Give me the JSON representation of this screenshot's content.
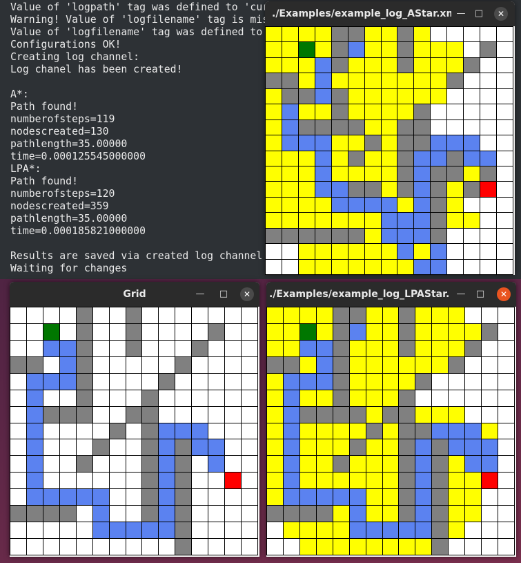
{
  "terminal": {
    "lines": [
      "Value of 'logpath' tag was defined to 'current directory'",
      "Warning! Value of 'logfilename' tag is missing!",
      "Value of 'logfilename' tag was defined to 'inputfilename_log.xml'",
      "Configurations OK!",
      "Creating log channel:",
      "Log chanel has been created!",
      "",
      "A*:",
      "Path found!",
      "numberofsteps=119",
      "nodescreated=130",
      "pathlength=35.00000",
      "time=0.000125545000000",
      "LPA*:",
      "Path found!",
      "numberofsteps=120",
      "nodescreated=359",
      "pathlength=35.00000",
      "time=0.000185821000000",
      "",
      "Results are saved via created log channel",
      "Waiting for changes"
    ]
  },
  "legend_colors": {
    "w": "#ffffff",
    "y": "#ffff00",
    "g": "#808080",
    "b": "#5b82f0",
    "s": "#007700",
    "e": "#ff0000"
  },
  "window_controls": {
    "minimize": "—",
    "maximize": "□",
    "close": "✕"
  },
  "windows": {
    "astar": {
      "title": "./Examples/example_log_AStar.xml",
      "cells": [
        "yyyyggyygywwwww",
        "yysygbyygyyywgw",
        "yyybgyyygyyygww",
        "ggybyyyyyyygwww",
        "yggbgyyyyyywwww",
        "ybyygyyyygwwwww",
        "ybggggyyggwwwww",
        "ybbbyygyggbbbww",
        "yyybygyygbbgbbw",
        "yyybyyyygbggygw",
        "yyybbggygbgygew",
        "yyyybbbbybgywww",
        "yyyyyyybbbgyyww",
        "ggggggybbbgwwww",
        "wwyyyyyybybwwww",
        "wwyyyyyyybbwwww"
      ]
    },
    "grid": {
      "title": "Grid",
      "cells": [
        "wwwwgwwgwwwwwww",
        "wwswgwwgwwwwgww",
        "wwbbgwwgwwwgwww",
        "ggwbgwwwwwgwwww",
        "wbbbgwwwwgwwwww",
        "wbwwgwwwgwwwwww",
        "wbgggwwggwwwwww",
        "wbwwwwgwgbbbwww",
        "wbwwwgwwgbgbbww",
        "wbwwgwwwgbgwbww",
        "wbwwwwwwgbgwwew",
        "wbbbbbwwgbgwwww",
        "ggggwbwwgbgwwww",
        "wwwwwbbbbbgwwww",
        "wwwwwwwwwwgwwww"
      ]
    },
    "lpastar": {
      "title": "./Examples/example_log_LPAStar....",
      "cells": [
        "yyyyggyygyyywww",
        "yysygbyygyyyygw",
        "yybbgyyygyyygww",
        "ggybgyyyyyygwww",
        "ybbbgyyyygwwwww",
        "ybyygyyygwwwwww",
        "ybggggyggyyywww",
        "ybyyyygyggbbbyw",
        "ybyyygyygbgbbbw",
        "ybyygyyygbgybbw",
        "ybyyyyyygbgyyew",
        "ybbbbbyygbgyyww",
        "ggggybyygbgyyww",
        "wyyyybbbbbgywww",
        "wwyyyyyyyygwwww"
      ]
    }
  }
}
